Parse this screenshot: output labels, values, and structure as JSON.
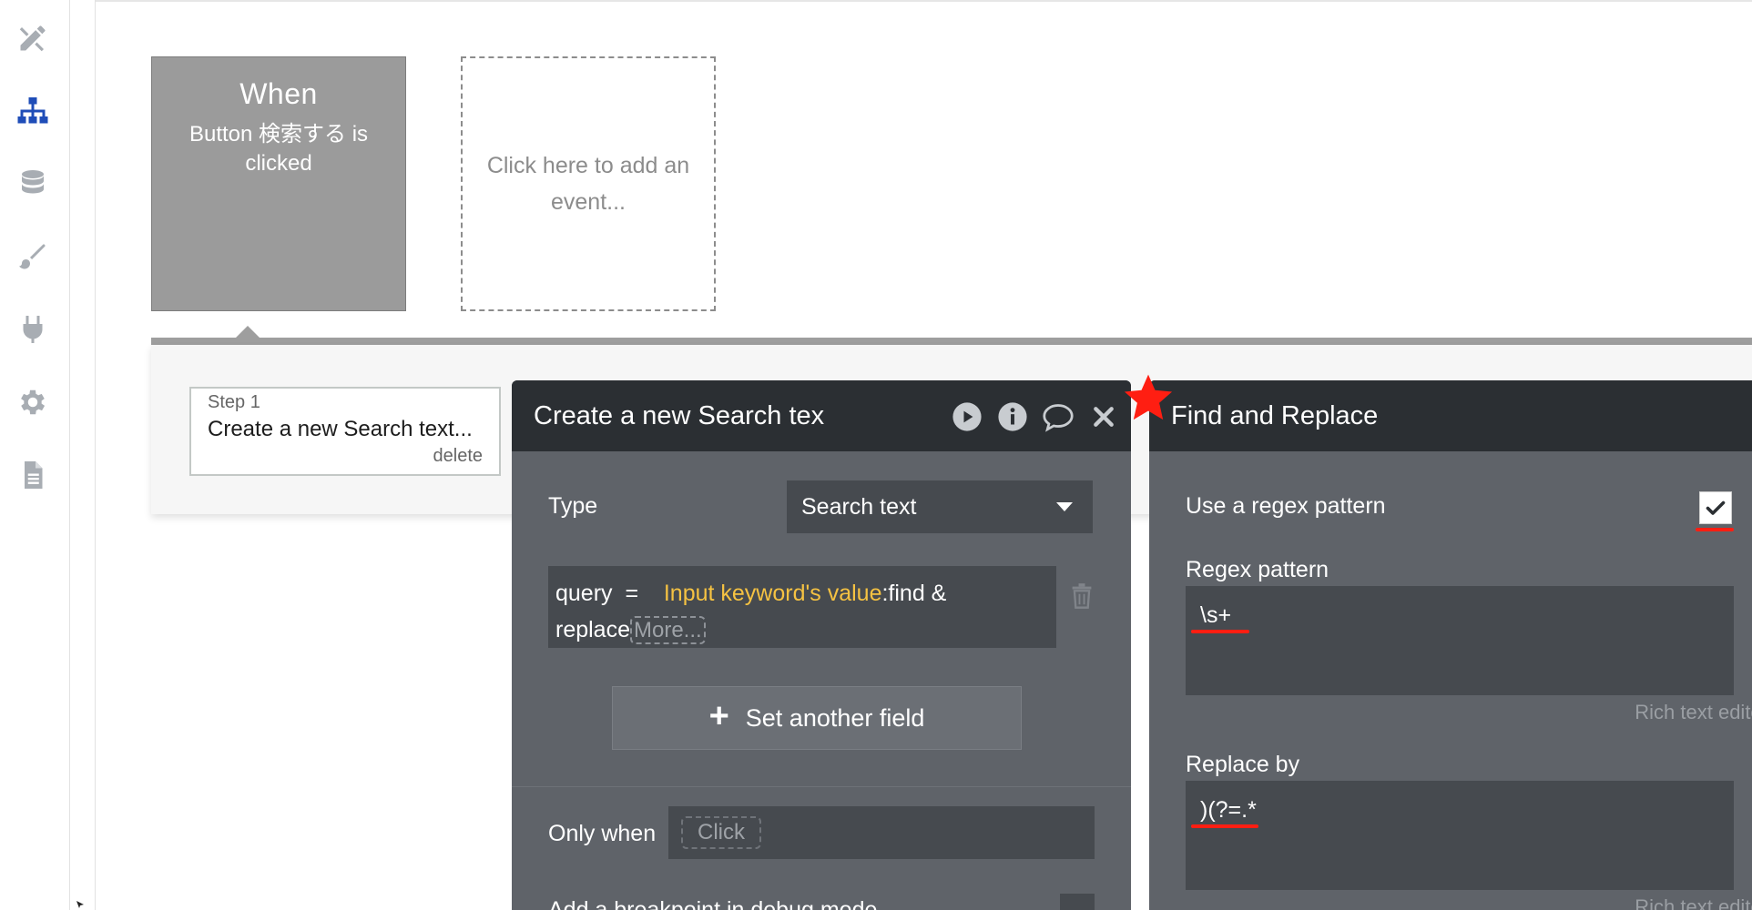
{
  "sidebar": {
    "items": [
      {
        "id": "design",
        "icon": "design-tools-icon"
      },
      {
        "id": "workflow",
        "icon": "workflow-tree-icon",
        "active": true
      },
      {
        "id": "data",
        "icon": "database-icon"
      },
      {
        "id": "styles",
        "icon": "paintbrush-icon"
      },
      {
        "id": "plugins",
        "icon": "plug-icon"
      },
      {
        "id": "settings",
        "icon": "gear-icon"
      },
      {
        "id": "logs",
        "icon": "document-icon"
      }
    ],
    "active_color": "#1f4db8",
    "icon_color": "#a8adb3"
  },
  "event_card": {
    "title": "When",
    "subtitle": "Button 検索する is clicked"
  },
  "add_event": {
    "label": "Click here to add an event..."
  },
  "step": {
    "number": "Step 1",
    "title": "Create a new Search text...",
    "delete_label": "delete"
  },
  "action_panel": {
    "title": "Create a new Search tex",
    "type_label": "Type",
    "type_value": "Search text",
    "field_name": "query",
    "field_op": "=",
    "field_expr_highlight": "Input keyword's value",
    "field_expr_rest": ":find &",
    "field_expr_line2": "replace",
    "more_label": "More...",
    "add_field_label": "Set another field",
    "only_when_label": "Only when",
    "only_when_placeholder": "Click",
    "breakpoint_label": "Add a breakpoint in debug mode",
    "icons": [
      "play-icon",
      "info-icon",
      "comment-icon",
      "close-icon"
    ]
  },
  "find_replace_panel": {
    "title": "Find and Replace",
    "use_regex_label": "Use a regex pattern",
    "use_regex_checked": true,
    "regex_label": "Regex pattern",
    "regex_value": "\\s+",
    "rich_text_label": "Rich text editor",
    "replace_label": "Replace by",
    "replace_value": ")(?=.*",
    "rich_text_label_2": "Rich text editor"
  },
  "annotation": {
    "star_color": "#ff1e12",
    "underline_color": "#ff1e12"
  }
}
